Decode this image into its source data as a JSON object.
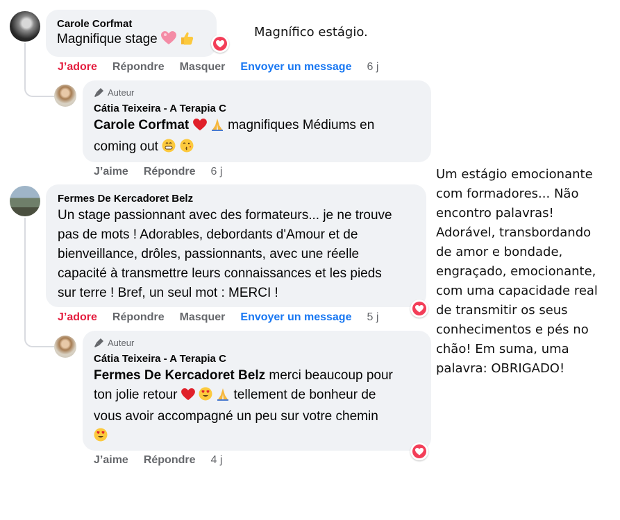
{
  "comments": [
    {
      "author": "Carole Corfmat",
      "text": "Magnifique stage",
      "actions": {
        "love": "J’adore",
        "reply": "Répondre",
        "hide": "Masquer",
        "message": "Envoyer un message",
        "time": "6 j"
      },
      "reply": {
        "badge": "Auteur",
        "author": "Cátia Teixeira - A Terapia C",
        "mention": "Carole Corfmat",
        "text_line1": "magnifiques Médiums en",
        "text_line2": "coming out",
        "actions": {
          "like": "J’aime",
          "reply": "Répondre",
          "time": "6 j"
        }
      }
    },
    {
      "author": "Fermes De Kercadoret Belz",
      "lines": [
        "Un stage passionnant avec des formateurs... je ne trouve",
        "pas de mots ! Adorables, debordants d'Amour et de",
        "bienveillance, drôles, passionnants, avec une réelle",
        "capacité à transmettre leurs connaissances et les pieds",
        "sur terre ! Bref, un seul mot : MERCI !"
      ],
      "actions": {
        "love": "J’adore",
        "reply": "Répondre",
        "hide": "Masquer",
        "message": "Envoyer un message",
        "time": "5 j"
      },
      "reply": {
        "badge": "Auteur",
        "author": "Cátia Teixeira - A Terapia C",
        "mention": "Fermes De Kercadoret Belz",
        "line1": "merci beaucoup pour",
        "line2a": "ton jolie retour",
        "line2b": "tellement de bonheur de",
        "line3": "vous avoir accompagné un peu sur votre chemin",
        "actions": {
          "like": "J’aime",
          "reply": "Répondre",
          "time": "4 j"
        }
      }
    }
  ],
  "translations": {
    "first": "Magnífico estágio.",
    "second": [
      "Um estágio emocionante",
      "com formadores... Não",
      "encontro palavras!",
      "Adorável, transbordando",
      "de amor e bondade,",
      "engraçado, emocionante,",
      "com uma capacidade real",
      "de transmitir os seus",
      "conhecimentos e pés no",
      "chão! Em suma, uma",
      "palavra: OBRIGADO!"
    ]
  }
}
